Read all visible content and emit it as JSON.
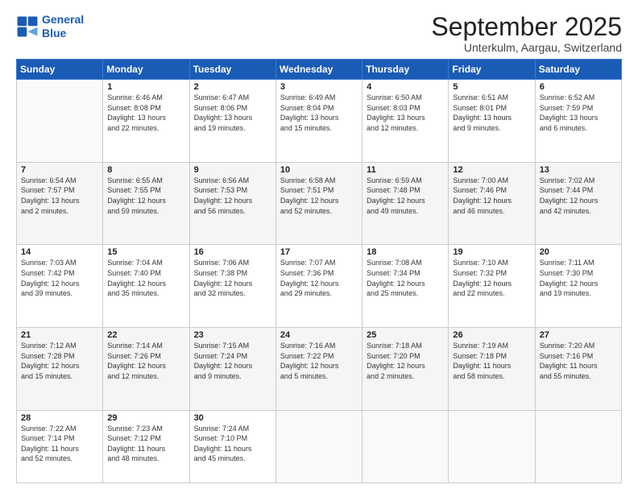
{
  "logo": {
    "line1": "General",
    "line2": "Blue"
  },
  "title": "September 2025",
  "subtitle": "Unterkulm, Aargau, Switzerland",
  "weekdays": [
    "Sunday",
    "Monday",
    "Tuesday",
    "Wednesday",
    "Thursday",
    "Friday",
    "Saturday"
  ],
  "weeks": [
    [
      {
        "day": "",
        "info": ""
      },
      {
        "day": "1",
        "info": "Sunrise: 6:46 AM\nSunset: 8:08 PM\nDaylight: 13 hours\nand 22 minutes."
      },
      {
        "day": "2",
        "info": "Sunrise: 6:47 AM\nSunset: 8:06 PM\nDaylight: 13 hours\nand 19 minutes."
      },
      {
        "day": "3",
        "info": "Sunrise: 6:49 AM\nSunset: 8:04 PM\nDaylight: 13 hours\nand 15 minutes."
      },
      {
        "day": "4",
        "info": "Sunrise: 6:50 AM\nSunset: 8:03 PM\nDaylight: 13 hours\nand 12 minutes."
      },
      {
        "day": "5",
        "info": "Sunrise: 6:51 AM\nSunset: 8:01 PM\nDaylight: 13 hours\nand 9 minutes."
      },
      {
        "day": "6",
        "info": "Sunrise: 6:52 AM\nSunset: 7:59 PM\nDaylight: 13 hours\nand 6 minutes."
      }
    ],
    [
      {
        "day": "7",
        "info": "Sunrise: 6:54 AM\nSunset: 7:57 PM\nDaylight: 13 hours\nand 2 minutes."
      },
      {
        "day": "8",
        "info": "Sunrise: 6:55 AM\nSunset: 7:55 PM\nDaylight: 12 hours\nand 59 minutes."
      },
      {
        "day": "9",
        "info": "Sunrise: 6:56 AM\nSunset: 7:53 PM\nDaylight: 12 hours\nand 56 minutes."
      },
      {
        "day": "10",
        "info": "Sunrise: 6:58 AM\nSunset: 7:51 PM\nDaylight: 12 hours\nand 52 minutes."
      },
      {
        "day": "11",
        "info": "Sunrise: 6:59 AM\nSunset: 7:48 PM\nDaylight: 12 hours\nand 49 minutes."
      },
      {
        "day": "12",
        "info": "Sunrise: 7:00 AM\nSunset: 7:46 PM\nDaylight: 12 hours\nand 46 minutes."
      },
      {
        "day": "13",
        "info": "Sunrise: 7:02 AM\nSunset: 7:44 PM\nDaylight: 12 hours\nand 42 minutes."
      }
    ],
    [
      {
        "day": "14",
        "info": "Sunrise: 7:03 AM\nSunset: 7:42 PM\nDaylight: 12 hours\nand 39 minutes."
      },
      {
        "day": "15",
        "info": "Sunrise: 7:04 AM\nSunset: 7:40 PM\nDaylight: 12 hours\nand 35 minutes."
      },
      {
        "day": "16",
        "info": "Sunrise: 7:06 AM\nSunset: 7:38 PM\nDaylight: 12 hours\nand 32 minutes."
      },
      {
        "day": "17",
        "info": "Sunrise: 7:07 AM\nSunset: 7:36 PM\nDaylight: 12 hours\nand 29 minutes."
      },
      {
        "day": "18",
        "info": "Sunrise: 7:08 AM\nSunset: 7:34 PM\nDaylight: 12 hours\nand 25 minutes."
      },
      {
        "day": "19",
        "info": "Sunrise: 7:10 AM\nSunset: 7:32 PM\nDaylight: 12 hours\nand 22 minutes."
      },
      {
        "day": "20",
        "info": "Sunrise: 7:11 AM\nSunset: 7:30 PM\nDaylight: 12 hours\nand 19 minutes."
      }
    ],
    [
      {
        "day": "21",
        "info": "Sunrise: 7:12 AM\nSunset: 7:28 PM\nDaylight: 12 hours\nand 15 minutes."
      },
      {
        "day": "22",
        "info": "Sunrise: 7:14 AM\nSunset: 7:26 PM\nDaylight: 12 hours\nand 12 minutes."
      },
      {
        "day": "23",
        "info": "Sunrise: 7:15 AM\nSunset: 7:24 PM\nDaylight: 12 hours\nand 9 minutes."
      },
      {
        "day": "24",
        "info": "Sunrise: 7:16 AM\nSunset: 7:22 PM\nDaylight: 12 hours\nand 5 minutes."
      },
      {
        "day": "25",
        "info": "Sunrise: 7:18 AM\nSunset: 7:20 PM\nDaylight: 12 hours\nand 2 minutes."
      },
      {
        "day": "26",
        "info": "Sunrise: 7:19 AM\nSunset: 7:18 PM\nDaylight: 11 hours\nand 58 minutes."
      },
      {
        "day": "27",
        "info": "Sunrise: 7:20 AM\nSunset: 7:16 PM\nDaylight: 11 hours\nand 55 minutes."
      }
    ],
    [
      {
        "day": "28",
        "info": "Sunrise: 7:22 AM\nSunset: 7:14 PM\nDaylight: 11 hours\nand 52 minutes."
      },
      {
        "day": "29",
        "info": "Sunrise: 7:23 AM\nSunset: 7:12 PM\nDaylight: 11 hours\nand 48 minutes."
      },
      {
        "day": "30",
        "info": "Sunrise: 7:24 AM\nSunset: 7:10 PM\nDaylight: 11 hours\nand 45 minutes."
      },
      {
        "day": "",
        "info": ""
      },
      {
        "day": "",
        "info": ""
      },
      {
        "day": "",
        "info": ""
      },
      {
        "day": "",
        "info": ""
      }
    ]
  ]
}
